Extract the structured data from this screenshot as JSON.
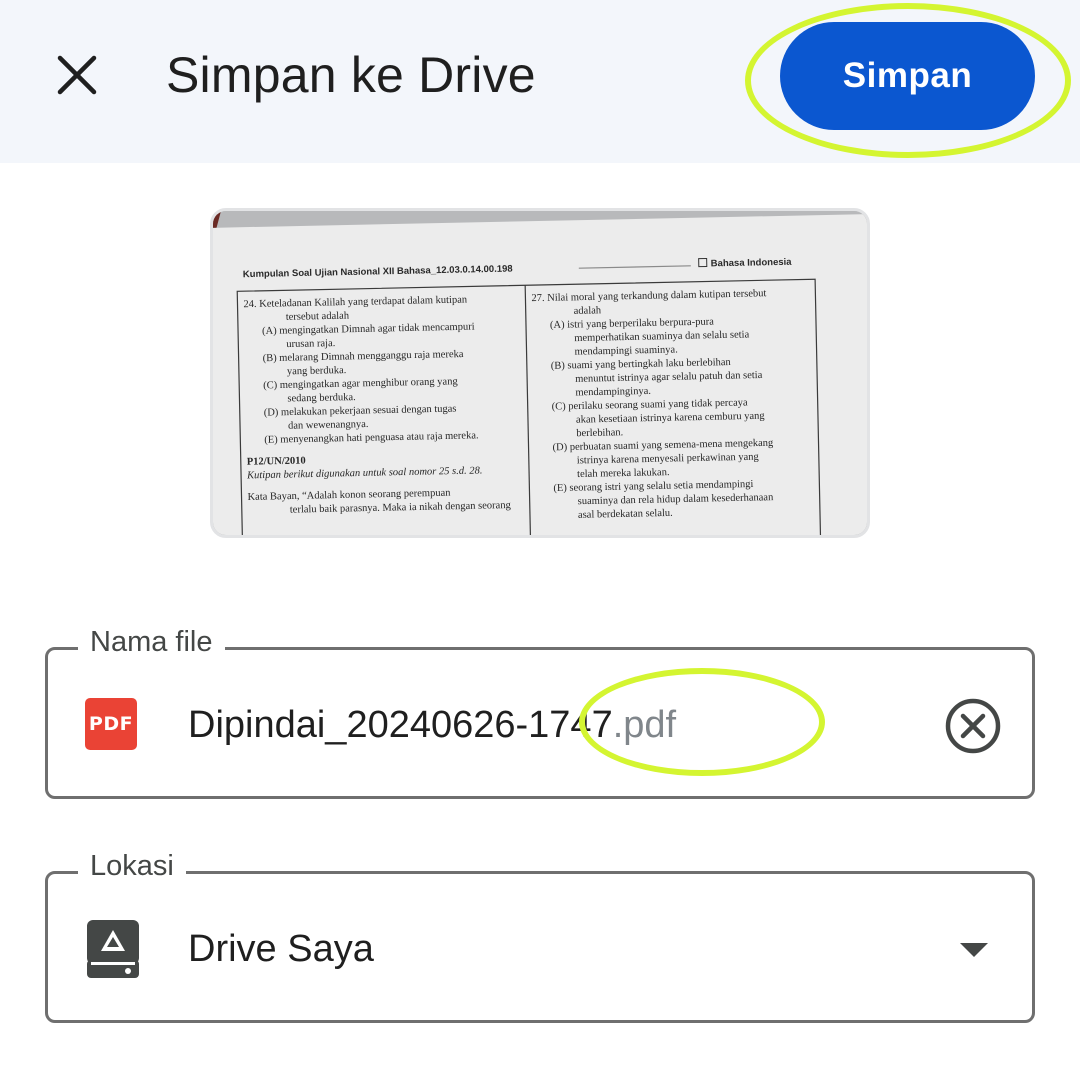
{
  "header": {
    "title": "Simpan ke Drive",
    "save_label": "Simpan",
    "close_icon": "close-icon"
  },
  "preview": {
    "document_header_left": "Kumpulan Soal Ujian Nasional XII Bahasa_12.03.0.14.00.198",
    "document_header_right": "Bahasa Indonesia",
    "left_column": [
      "24. Keteladanan Kalilah yang terdapat dalam kutipan",
      "tersebut adalah",
      "(A) mengingatkan Dimnah agar tidak mencampuri",
      "urusan raja.",
      "(B) melarang Dimnah mengganggu raja mereka",
      "yang berduka.",
      "(C) mengingatkan agar menghibur orang yang",
      "sedang berduka.",
      "(D) melakukan pekerjaan sesuai dengan tugas",
      "dan wewenangnya.",
      "(E) menyenangkan hati penguasa atau raja mereka.",
      "",
      "P12/UN/2010",
      "Kutipan berikut digunakan untuk soal nomor 25 s.d. 28.",
      "",
      "Kata Bayan, “Adalah konon seorang perempuan",
      "terlalu baik parasnya. Maka ia nikah dengan seorang"
    ],
    "right_column": [
      "27. Nilai moral yang terkandung dalam kutipan tersebut",
      "adalah",
      "(A) istri yang berperilaku berpura-pura",
      "memperhatikan suaminya dan selalu setia",
      "mendampingi suaminya.",
      "(B) suami yang bertingkah laku berlebihan",
      "menuntut istrinya agar selalu patuh dan setia",
      "mendampinginya.",
      "(C) perilaku seorang suami yang tidak percaya",
      "akan kesetiaan istrinya karena cemburu yang",
      "berlebihan.",
      "(D) perbuatan suami yang semena-mena mengekang",
      "istrinya karena menyesali perkawinan yang",
      "telah mereka lakukan.",
      "(E) seorang istri yang selalu setia mendampingi",
      "suaminya dan rela hidup dalam kesederhanaan",
      "asal berdekatan selalu."
    ]
  },
  "file_name_field": {
    "label": "Nama file",
    "value": "Dipindai_20240626-1747",
    "extension": ".pdf",
    "file_icon": "pdf-icon",
    "file_icon_text": "PDF",
    "clear_icon": "clear-circle-icon"
  },
  "location_field": {
    "label": "Lokasi",
    "value": "Drive Saya",
    "location_icon": "drive-icon",
    "dropdown_icon": "dropdown-arrow-icon"
  },
  "colors": {
    "primary": "#0b57d0",
    "header_bg": "#f3f6fb",
    "highlight": "#d4f531",
    "pdf_red": "#ea4335"
  }
}
